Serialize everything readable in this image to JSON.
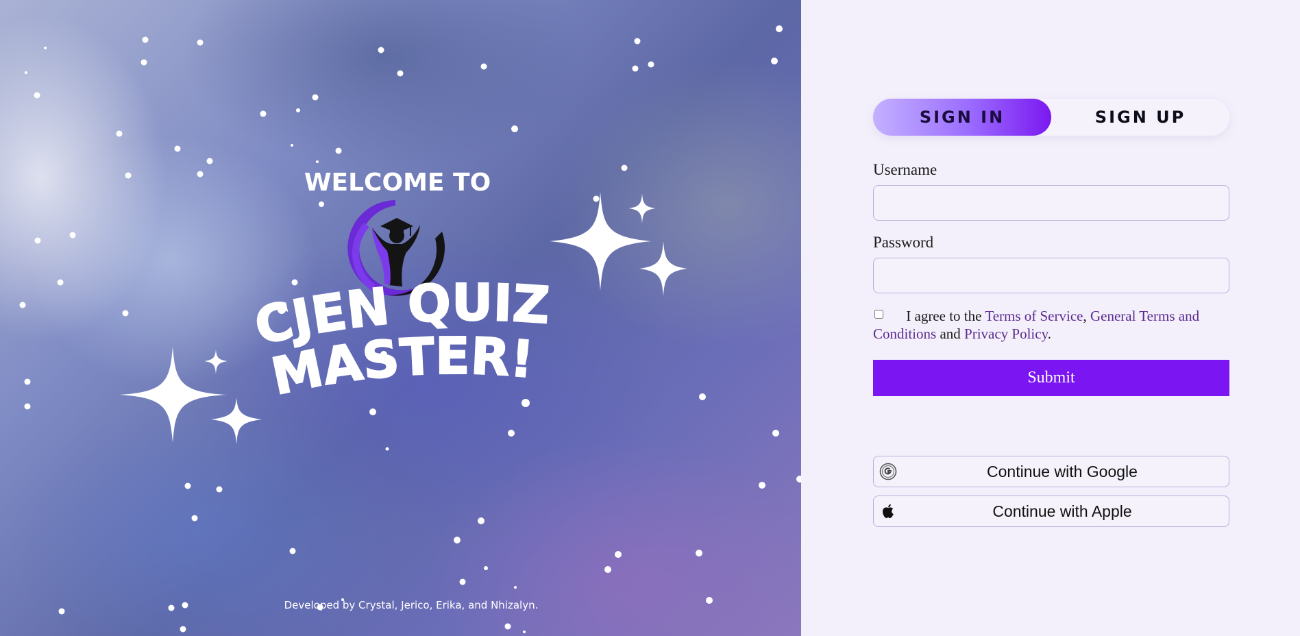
{
  "hero": {
    "welcome_text": "WELCOME TO",
    "title_line1": "CJEN QUIZ",
    "title_line2": "MASTER!",
    "credit": "Developed by Crystal, Jerico, Erika, and Nhizalyn.",
    "logo_icon": "graduate-cap-icon"
  },
  "auth": {
    "tabs": [
      {
        "label": "SIGN IN",
        "active": true
      },
      {
        "label": "SIGN UP",
        "active": false
      }
    ],
    "username_label": "Username",
    "username_value": "",
    "password_label": "Password",
    "password_value": "",
    "agree": {
      "checked": false,
      "prefix": "I agree to the",
      "terms_link": "Terms of Service",
      "sep1": ",",
      "general_link": "General Terms and Conditions",
      "and": "and",
      "privacy_link": "Privacy Policy",
      "end": "."
    },
    "submit_label": "Submit",
    "google_label": "Continue with Google",
    "google_icon": "google-icon",
    "apple_label": "Continue with Apple",
    "apple_icon": "apple-icon"
  },
  "colors": {
    "accent": "#7b16f2",
    "panel_bg": "#f3f0fb",
    "link": "#5b2a8f",
    "input_border": "#b9b0dc"
  }
}
